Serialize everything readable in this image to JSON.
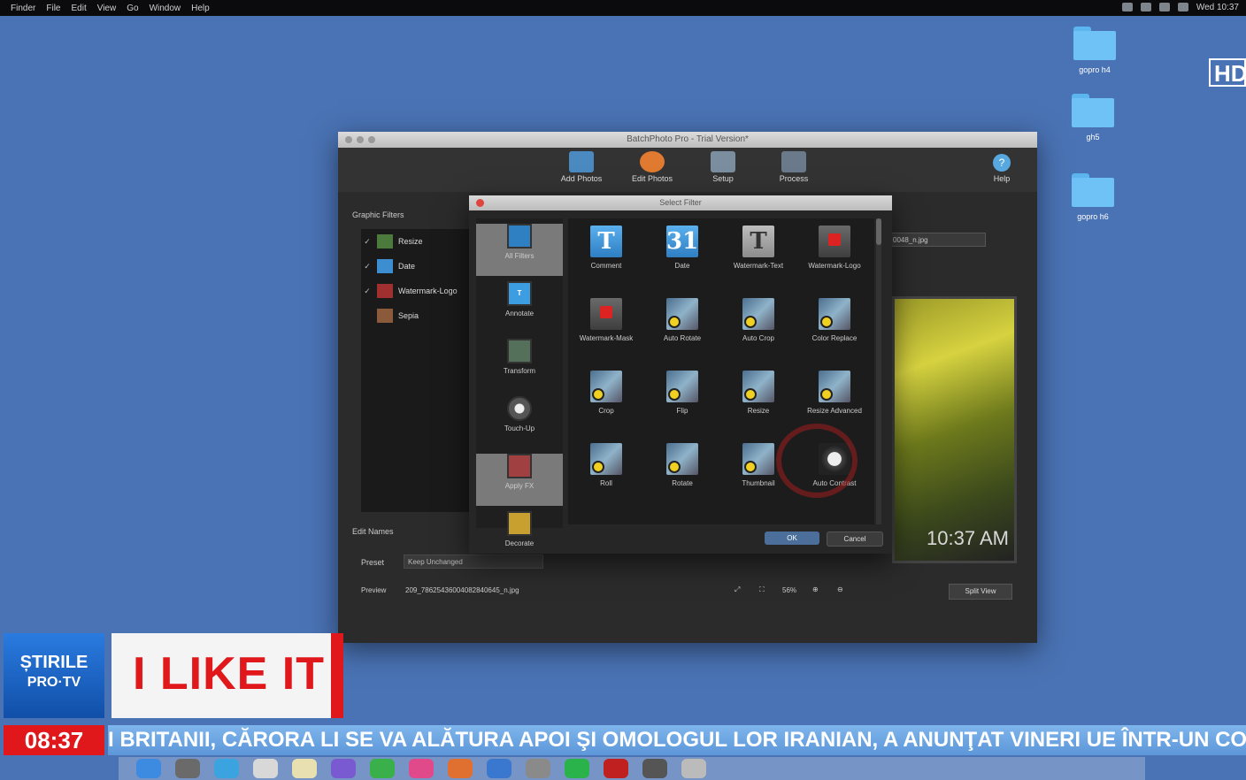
{
  "menubar": {
    "items": [
      "Finder",
      "File",
      "Edit",
      "View",
      "Go",
      "Window",
      "Help"
    ],
    "clock": "Wed 10:37"
  },
  "desktop": {
    "icons": [
      "gopro h4",
      "gh5",
      "gopro h6"
    ],
    "hd_badge": "HD"
  },
  "window": {
    "title": "BatchPhoto Pro - Trial Version*",
    "toolbar": [
      {
        "label": "Add Photos",
        "icon": "add-photos-icon",
        "color": "#4a8ac0"
      },
      {
        "label": "Edit Photos",
        "icon": "edit-photos-icon",
        "color": "#e07a30"
      },
      {
        "label": "Setup",
        "icon": "setup-icon",
        "color": "#7a8ea0"
      },
      {
        "label": "Process",
        "icon": "process-icon",
        "color": "#6a7a8a"
      }
    ],
    "help_label": "Help",
    "graphic_filters_label": "Graphic Filters",
    "filters": [
      {
        "name": "Resize",
        "checked": "✓",
        "icon": "resize-filter-icon",
        "color": "#4c7a3c"
      },
      {
        "name": "Date",
        "checked": "✓",
        "icon": "date-filter-icon",
        "color": "#3c8ed0"
      },
      {
        "name": "Watermark-Logo",
        "checked": "✓",
        "icon": "watermark-logo-filter-icon",
        "color": "#a03030"
      },
      {
        "name": "Sepia",
        "checked": "",
        "icon": "sepia-filter-icon",
        "color": "#8a5a3a"
      }
    ],
    "file_select": "0048_n.jpg",
    "timestamp_overlay": "10:37 AM",
    "edit_names_label": "Edit Names",
    "preset_label": "Preset",
    "preset_value": "Keep Unchanged",
    "preview_label": "Preview",
    "preview_filename": "209_78625436004082840645_n.jpg",
    "zoom": "56%",
    "split_view": "Split View"
  },
  "dialog": {
    "title": "Select Filter",
    "categories": [
      {
        "label": "All Filters",
        "selected": true
      },
      {
        "label": "Annotate",
        "selected": false
      },
      {
        "label": "Transform",
        "selected": false
      },
      {
        "label": "Touch-Up",
        "selected": false
      },
      {
        "label": "Apply FX",
        "selected": true
      },
      {
        "label": "Decorate",
        "selected": false
      }
    ],
    "filters": [
      {
        "label": "Comment",
        "style": "T",
        "glyph": "T"
      },
      {
        "label": "Date",
        "style": "T",
        "glyph": "31"
      },
      {
        "label": "Watermark-Text",
        "style": "Tg",
        "glyph": "T"
      },
      {
        "label": "Watermark-Logo",
        "style": "redsq",
        "glyph": ""
      },
      {
        "label": "Watermark-Mask",
        "style": "redsq",
        "glyph": ""
      },
      {
        "label": "Auto Rotate",
        "style": "photoic",
        "glyph": ""
      },
      {
        "label": "Auto Crop",
        "style": "photoic",
        "glyph": ""
      },
      {
        "label": "Color Replace",
        "style": "photoic",
        "glyph": ""
      },
      {
        "label": "Crop",
        "style": "photoic",
        "glyph": ""
      },
      {
        "label": "Flip",
        "style": "photoic",
        "glyph": ""
      },
      {
        "label": "Resize",
        "style": "photoic",
        "glyph": ""
      },
      {
        "label": "Resize Advanced",
        "style": "photoic",
        "glyph": ""
      },
      {
        "label": "Roll",
        "style": "photoic",
        "glyph": ""
      },
      {
        "label": "Rotate",
        "style": "photoic",
        "glyph": ""
      },
      {
        "label": "Thumbnail",
        "style": "photoic",
        "glyph": ""
      },
      {
        "label": "Auto Contrast",
        "style": "dial",
        "glyph": ""
      }
    ],
    "ok": "OK",
    "cancel": "Cancel"
  },
  "news": {
    "logo_line1": "ȘTIRILE",
    "logo_line2": "PRO·TV",
    "show": "I LIKE IT",
    "clock": "08:37",
    "ticker": "I BRITANII, CĂRORA LI SE VA ALĂTURA APOI ŞI OMOLOGUL LOR IRANIAN, A ANUNŢAT VINERI UE ÎNTR-UN COMUNICAT"
  }
}
